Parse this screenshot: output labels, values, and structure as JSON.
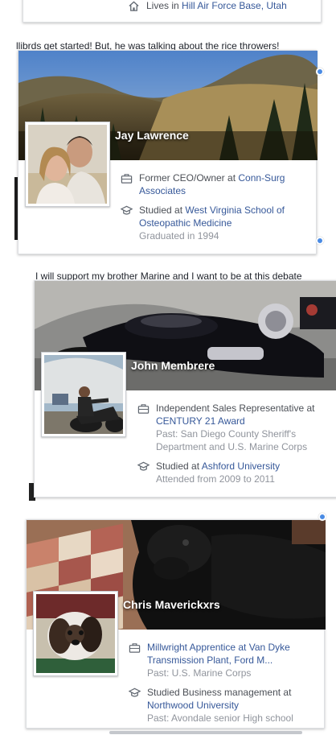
{
  "cards": [
    {
      "lives_prefix": "Lives in",
      "lives_place": "Hill Air Force Base, Utah"
    },
    {
      "snippet": "llibrds get started! But, he was talking about the rice throwers!",
      "name": "Jay Lawrence",
      "work_prefix": "Former CEO/Owner at",
      "work_place": "Conn-Surg Associates",
      "edu_prefix": "Studied at",
      "edu_place": "West Virginia School of Osteopathic Medicine",
      "edu_detail": "Graduated in 1994"
    },
    {
      "snippet": "I will support my brother Marine and I want to be at this debate",
      "name": "John Membrere",
      "work_prefix": "Independent Sales Representative at",
      "work_place": "CENTURY 21 Award",
      "work_past": "Past: San Diego County Sheriff's Department and U.S. Marine Corps",
      "edu_prefix": "Studied at",
      "edu_place": "Ashford University",
      "edu_detail": "Attended from 2009 to 2011"
    },
    {
      "name": "Chris Maverickxrs",
      "work_link": "Millwright Apprentice at Van Dyke Transmission Plant, Ford M...",
      "work_past": "Past: U.S. Marine Corps",
      "edu_prefix": "Studied Business management at",
      "edu_place": "Northwood University",
      "edu_detail": "Past: Avondale senior High school"
    }
  ]
}
